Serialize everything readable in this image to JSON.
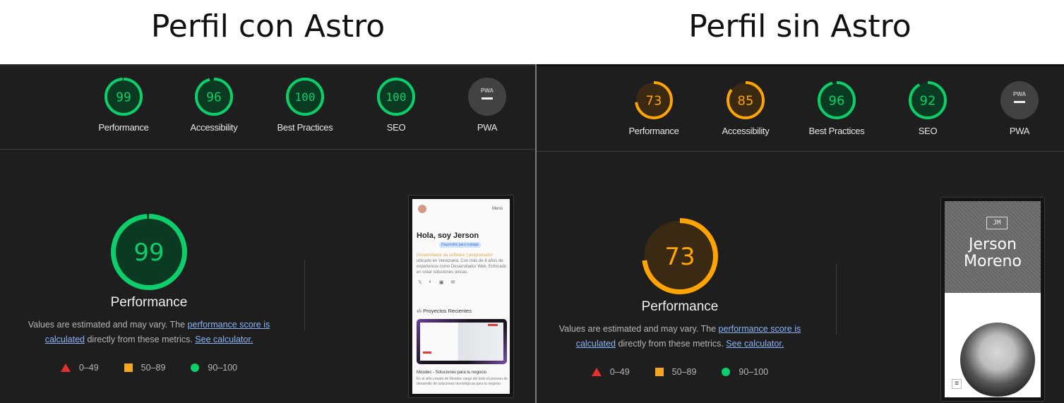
{
  "titles": {
    "left": "Perfil con Astro",
    "right": "Perfil sin Astro"
  },
  "colors": {
    "pass": "#0cce6b",
    "average": "#ffa400",
    "fail": "#ff4e42",
    "link": "#8ab4f8",
    "panel_bg": "#1e1e1e"
  },
  "reports": [
    {
      "id": "con-astro",
      "gauges": [
        {
          "label": "Performance",
          "score": 99,
          "rating": "pass"
        },
        {
          "label": "Accessibility",
          "score": 96,
          "rating": "pass"
        },
        {
          "label": "Best Practices",
          "score": 100,
          "rating": "pass"
        },
        {
          "label": "SEO",
          "score": 100,
          "rating": "pass"
        },
        {
          "label": "PWA",
          "score": null,
          "rating": "na",
          "badge_text": "PWA"
        }
      ],
      "main": {
        "score": 99,
        "rating": "pass",
        "title": "Performance",
        "desc_prefix": "Values are estimated and may vary. The ",
        "link1": "performance score is calculated",
        "desc_mid": " directly from these metrics. ",
        "link2": "See calculator."
      },
      "screenshot": {
        "nav_menu": "Menú",
        "heading": "Hola, soy Jerson",
        "badge": "Disponible para trabajar",
        "highlight": "Desarrollador de software | programador",
        "bio": "ubicado en Venezuela. Con más de 8 años de experiencia como Desarrollador Web. Enfocado en crear soluciones únicas.",
        "section_title": "Proyectos Recientes",
        "project_title": "Moodec - Soluciones para tu negocio",
        "project_desc": "En el sitio creado de Moodec cargo del todo el proceso de desarrollo de soluciones tecnológicas para tu negocio."
      }
    },
    {
      "id": "sin-astro",
      "gauges": [
        {
          "label": "Performance",
          "score": 73,
          "rating": "average"
        },
        {
          "label": "Accessibility",
          "score": 85,
          "rating": "average"
        },
        {
          "label": "Best Practices",
          "score": 96,
          "rating": "pass"
        },
        {
          "label": "SEO",
          "score": 92,
          "rating": "pass"
        },
        {
          "label": "PWA",
          "score": null,
          "rating": "na",
          "badge_text": "PWA"
        }
      ],
      "main": {
        "score": 73,
        "rating": "average",
        "title": "Performance",
        "desc_prefix": "Values are estimated and may vary. The ",
        "link1": "performance score is calculated",
        "desc_mid": " directly from these metrics. ",
        "link2": "See calculator."
      },
      "screenshot": {
        "monogram": "JM",
        "name_line1": "Jerson",
        "name_line2": "Moreno"
      }
    }
  ],
  "legend": [
    {
      "shape": "triangle",
      "range": "0–49"
    },
    {
      "shape": "square",
      "range": "50–89"
    },
    {
      "shape": "circle",
      "range": "90–100"
    }
  ]
}
